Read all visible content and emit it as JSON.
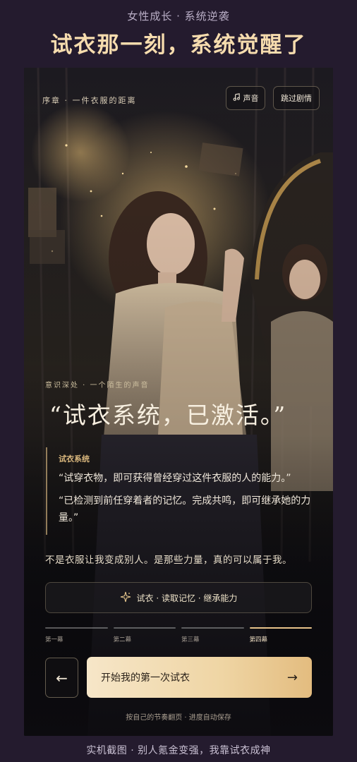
{
  "header": {
    "caption": "女性成长 · 系统逆袭",
    "headline": "试衣那一刻，系统觉醒了"
  },
  "phone": {
    "chapter": "序章  ·  一件衣服的距离",
    "sound_label": "声音",
    "skip_label": "跳过剧情",
    "subtitle": "意识深处  ·  一个陌生的声音",
    "big_quote": "“试衣系统，已激活。”",
    "system": {
      "name": "试衣系统",
      "line1": "“试穿衣物，即可获得曾经穿过这件衣服的人的能力。”",
      "line2": "“已检测到前任穿着者的记忆。完成共鸣，即可继承她的力量。”"
    },
    "narration": "不是衣服让我变成别人。是那些力量，真的可以属于我。",
    "action": "试衣 · 读取记忆 · 继承能力",
    "chapters": [
      "第一幕",
      "第二幕",
      "第三幕",
      "第四幕"
    ],
    "active_chapter": 3,
    "back_glyph": "←",
    "start_label": "开始我的第一次试衣",
    "start_glyph": "→",
    "hint": "按自己的节奏翻页 · 进度自动保存"
  },
  "footer": {
    "caption": "实机截图 · 别人氪金变强，我靠试衣成神"
  },
  "colors": {
    "background": "#241b2e",
    "headline": "#f6dcae",
    "accent_gold": "#e6c28a",
    "button_gradient_start": "#f6e6c8",
    "button_gradient_end": "#e3bc7f"
  }
}
